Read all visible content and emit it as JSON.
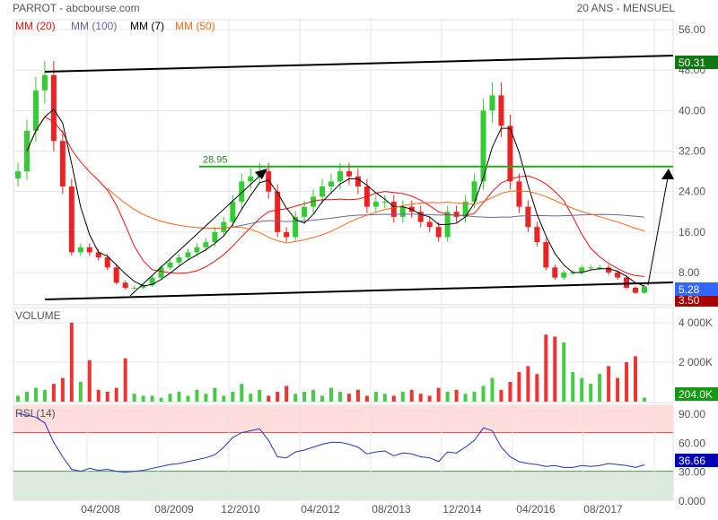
{
  "header": {
    "title": "PARROT - abcbourse.com",
    "period": "20 ANS - MENSUEL"
  },
  "legend": [
    {
      "label": "MM (20)",
      "color": "#ee1111"
    },
    {
      "label": "MM (100)",
      "color": "#666699"
    },
    {
      "label": "MM (7)",
      "color": "#000000"
    },
    {
      "label": "MM (50)",
      "color": "#ff6611"
    }
  ],
  "chart_data": {
    "type": "candlestick",
    "price_axis": {
      "ticks": [
        "56.00",
        "48.00",
        "40.00",
        "32.00",
        "24.00",
        "16.00",
        "8.00"
      ],
      "tick_values": [
        56,
        48,
        40,
        32,
        24,
        16,
        8
      ],
      "range": [
        4.5,
        56
      ]
    },
    "date_ticks": [
      "04/2008",
      "08/2009",
      "12/2010",
      "04/2012",
      "08/2013",
      "12/2014",
      "04/2016",
      "08/2017"
    ],
    "closes": [
      28,
      36,
      44,
      47,
      34,
      25,
      12,
      13,
      12,
      11,
      9,
      6,
      5,
      5,
      5.5,
      7,
      9,
      10,
      11,
      12,
      13,
      14,
      16,
      18,
      22,
      26,
      27,
      28,
      24,
      16,
      15,
      19,
      21,
      23,
      25,
      26,
      28,
      27,
      25,
      21,
      22,
      22,
      19,
      21,
      20,
      18,
      17,
      15,
      20,
      19,
      22,
      26,
      40,
      43,
      37,
      26,
      21,
      17,
      14,
      9,
      7,
      8,
      8,
      9,
      9,
      9,
      8,
      7,
      5,
      4,
      5.28
    ],
    "volumes_k": [
      300,
      500,
      700,
      600,
      900,
      1200,
      4000,
      1000,
      2100,
      600,
      500,
      700,
      2200,
      400,
      300,
      300,
      200,
      400,
      500,
      300,
      600,
      400,
      700,
      300,
      500,
      900,
      400,
      600,
      300,
      500,
      800,
      400,
      500,
      600,
      300,
      700,
      500,
      400,
      600,
      300,
      500,
      400,
      300,
      500,
      600,
      400,
      300,
      700,
      500,
      600,
      400,
      500,
      800,
      1200,
      600,
      1000,
      1500,
      1800,
      1400,
      3400,
      3300,
      3000,
      1500,
      1200,
      900,
      1400,
      1800,
      1200,
      2000,
      2300,
      204
    ],
    "rsi": [
      90,
      88,
      86,
      80,
      60,
      45,
      32,
      30,
      33,
      31,
      32,
      30,
      29,
      30,
      31,
      33,
      35,
      37,
      38,
      40,
      42,
      44,
      47,
      55,
      65,
      70,
      72,
      74,
      62,
      45,
      44,
      50,
      52,
      55,
      58,
      60,
      60,
      58,
      55,
      48,
      50,
      51,
      46,
      49,
      48,
      45,
      44,
      40,
      50,
      49,
      55,
      62,
      75,
      72,
      55,
      45,
      40,
      38,
      37,
      35,
      36,
      34,
      34,
      36,
      35,
      36,
      38,
      37,
      36,
      34,
      36.66
    ],
    "rsi_axis": {
      "ticks": [
        "90.00",
        "60.00",
        "30.00",
        "0.000"
      ],
      "tick_values": [
        90,
        60,
        30,
        0
      ],
      "overbought": 70,
      "oversold": 30
    },
    "volume_axis": {
      "ticks": [
        "4 000K",
        "2 000K"
      ],
      "tick_values": [
        4000,
        2000
      ]
    },
    "resistance_level": {
      "label": "28.95",
      "value": 28.95
    },
    "last_labels": {
      "high": "50.31",
      "close": "5.28",
      "low": "3.50",
      "volume": "204.0K",
      "rsi": "36.66"
    },
    "volume_label": "VOLUME",
    "rsi_label": "RSI (14)"
  }
}
